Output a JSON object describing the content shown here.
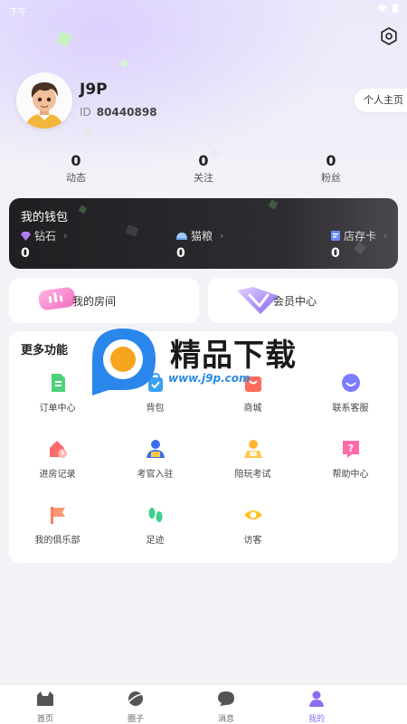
{
  "status_bar": {
    "time": "下午"
  },
  "profile": {
    "username": "J9P",
    "id_label": "ID",
    "id_value": "80440898",
    "home_button": "个人主页"
  },
  "stats": [
    {
      "value": "0",
      "label": "动态"
    },
    {
      "value": "0",
      "label": "关注"
    },
    {
      "value": "0",
      "label": "粉丝"
    }
  ],
  "wallet": {
    "title": "我的钱包",
    "items": [
      {
        "label": "钻石",
        "value": "0",
        "icon": "diamond-icon"
      },
      {
        "label": "猫粮",
        "value": "0",
        "icon": "cat-food-icon"
      },
      {
        "label": "店存卡",
        "value": "0",
        "icon": "store-card-icon"
      }
    ]
  },
  "cards": {
    "my_room": "我的房间",
    "vip_center": "会员中心"
  },
  "more": {
    "title": "更多功能",
    "items": [
      {
        "label": "订单中心",
        "icon": "order-icon"
      },
      {
        "label": "背包",
        "icon": "backpack-icon"
      },
      {
        "label": "商城",
        "icon": "mall-icon"
      },
      {
        "label": "联系客服",
        "icon": "customer-service-icon"
      },
      {
        "label": "进房记录",
        "icon": "room-record-icon"
      },
      {
        "label": "考官入驻",
        "icon": "examiner-icon"
      },
      {
        "label": "陪玩考试",
        "icon": "exam-icon"
      },
      {
        "label": "帮助中心",
        "icon": "help-icon"
      },
      {
        "label": "我的俱乐部",
        "icon": "club-icon"
      },
      {
        "label": "足迹",
        "icon": "footprint-icon"
      },
      {
        "label": "访客",
        "icon": "visitor-icon"
      }
    ]
  },
  "watermark": {
    "text": "精品下载",
    "url": "www.j9p.com"
  },
  "tabs": [
    {
      "label": "首页",
      "icon": "home-icon",
      "active": false
    },
    {
      "label": "圈子",
      "icon": "planet-icon",
      "active": false
    },
    {
      "label": "消息",
      "icon": "message-icon",
      "active": false
    },
    {
      "label": "我的",
      "icon": "profile-icon",
      "active": true
    }
  ],
  "colors": {
    "accent": "#8b6cf0",
    "wallet_bg": "#1f1f22",
    "page_bg": "#f2f3f7"
  }
}
